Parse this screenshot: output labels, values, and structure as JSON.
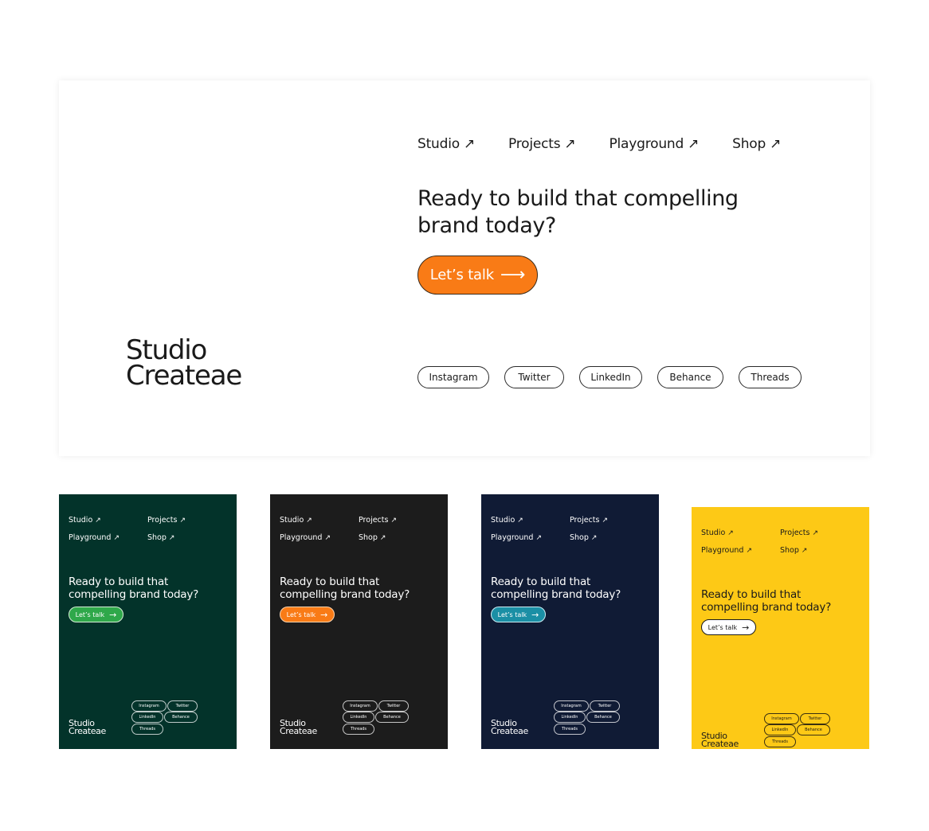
{
  "hero": {
    "nav": [
      {
        "label": "Studio",
        "icon": "arrow-up-right-icon",
        "glyph": "↗"
      },
      {
        "label": "Projects",
        "icon": "arrow-up-right-icon",
        "glyph": "↗"
      },
      {
        "label": "Playground",
        "icon": "arrow-up-right-icon",
        "glyph": "↗"
      },
      {
        "label": "Shop",
        "icon": "arrow-up-right-icon",
        "glyph": "↗"
      }
    ],
    "headline": "Ready to build that compelling brand today?",
    "cta": {
      "label": "Let’s talk",
      "icon": "arrow-right-icon",
      "glyph": "⟶",
      "color": "#f97b16"
    },
    "logo": {
      "line1": "Studio",
      "line2": "Createae"
    },
    "socials": [
      "Instagram",
      "Twitter",
      "LinkedIn",
      "Behance",
      "Threads"
    ]
  },
  "variants": [
    {
      "name": "green",
      "background": "#03332a",
      "accent": "#2fa84a",
      "nav": [
        {
          "label": "Studio",
          "glyph": "↗"
        },
        {
          "label": "Projects",
          "glyph": "↗"
        },
        {
          "label": "Playground",
          "glyph": "↗"
        },
        {
          "label": "Shop",
          "glyph": "↗"
        }
      ],
      "headline": "Ready to build that compelling brand today?",
      "cta": {
        "label": "Let’s talk",
        "glyph": "→"
      },
      "logo": {
        "line1": "Studio",
        "line2": "Createae"
      },
      "socials": [
        "Instagram",
        "Twitter",
        "LinkedIn",
        "Behance",
        "Threads"
      ]
    },
    {
      "name": "black",
      "background": "#1c1c1c",
      "accent": "#f97b16",
      "nav": [
        {
          "label": "Studio",
          "glyph": "↗"
        },
        {
          "label": "Projects",
          "glyph": "↗"
        },
        {
          "label": "Playground",
          "glyph": "↗"
        },
        {
          "label": "Shop",
          "glyph": "↗"
        }
      ],
      "headline": "Ready to build that compelling brand today?",
      "cta": {
        "label": "Let’s talk",
        "glyph": "→"
      },
      "logo": {
        "line1": "Studio",
        "line2": "Createae"
      },
      "socials": [
        "Instagram",
        "Twitter",
        "LinkedIn",
        "Behance",
        "Threads"
      ]
    },
    {
      "name": "navy",
      "background": "#101b35",
      "accent": "#1b8fa5",
      "nav": [
        {
          "label": "Studio",
          "glyph": "↗"
        },
        {
          "label": "Projects",
          "glyph": "↗"
        },
        {
          "label": "Playground",
          "glyph": "↗"
        },
        {
          "label": "Shop",
          "glyph": "↗"
        }
      ],
      "headline": "Ready to build that compelling brand today?",
      "cta": {
        "label": "Let’s talk",
        "glyph": "→"
      },
      "logo": {
        "line1": "Studio",
        "line2": "Createae"
      },
      "socials": [
        "Instagram",
        "Twitter",
        "LinkedIn",
        "Behance",
        "Threads"
      ]
    },
    {
      "name": "yellow",
      "background": "#fdc916",
      "accent": "#ffffff",
      "nav": [
        {
          "label": "Studio",
          "glyph": "↗"
        },
        {
          "label": "Projects",
          "glyph": "↗"
        },
        {
          "label": "Playground",
          "glyph": "↗"
        },
        {
          "label": "Shop",
          "glyph": "↗"
        }
      ],
      "headline": "Ready to build that compelling brand today?",
      "cta": {
        "label": "Let’s talk",
        "glyph": "→"
      },
      "logo": {
        "line1": "Studio",
        "line2": "Createae"
      },
      "socials": [
        "Instagram",
        "Twitter",
        "LinkedIn",
        "Behance",
        "Threads"
      ]
    }
  ]
}
